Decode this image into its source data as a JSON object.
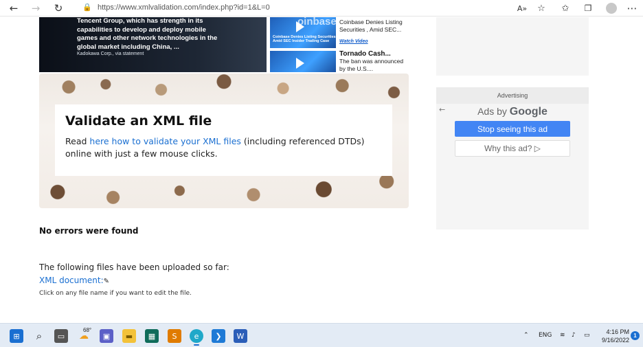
{
  "browser": {
    "url": "https://www.xmlvalidation.com/index.php?id=1&L=0",
    "icons": [
      "back-icon",
      "forward-icon",
      "refresh-icon",
      "lock-icon",
      "read-aloud-icon",
      "favorite-add-icon",
      "favorites-icon",
      "collections-icon",
      "profile-icon",
      "more-icon"
    ]
  },
  "news": {
    "main_headline": "Tencent Group, which has strength in its capabilities to develop and deploy mobile games and other network technologies in the global market including China, ...",
    "main_credit": "Kadokawa Corp., via statement",
    "thumb1_caption": "Coinbase Denies Listing Securities Amid SEC Insider Trading Case",
    "thumb1_brand": "oinbase",
    "story1_title": "Coinbase Denies Listing Securities , Amid SEC...",
    "story1_watch": "Watch Video",
    "story2_title": "Tornado Cash...",
    "story2_body": "The ban was announced by the U.S...."
  },
  "banner": {
    "title": "Validate an XML file",
    "text_before": "Read ",
    "link_text": "here how to validate your XML files",
    "text_after": " (including referenced DTDs) online with just a few mouse clicks."
  },
  "results": {
    "status": "No errors were found",
    "uploaded_label": "The following files have been uploaded so far:",
    "file_link": "XML document:",
    "hint": "Click on any file name if you want to edit the file."
  },
  "ad": {
    "label": "Advertising",
    "ads_by": "Ads by",
    "google": "Google",
    "stop_button": "Stop seeing this ad",
    "why_button": "Why this ad? ▷"
  },
  "taskbar": {
    "weather_temp": "68°",
    "language": "ENG",
    "time": "4:16 PM",
    "date": "9/16/2022",
    "notification_count": "1",
    "colors": {
      "accent": "#1a6fd1",
      "ad_button": "#4285f4"
    }
  }
}
